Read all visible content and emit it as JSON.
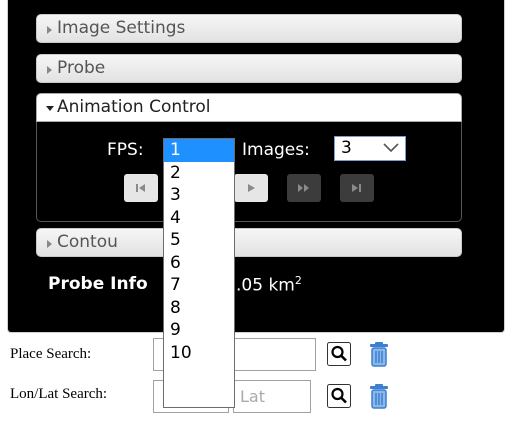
{
  "accordion": {
    "image_settings_label": "Image Settings",
    "probe_label": "Probe",
    "animation_control_label": "Animation Control",
    "contour_label": "Contou"
  },
  "animation": {
    "fps_label": "FPS:",
    "fps_value": "1",
    "images_label": "Images:",
    "images_value": "3",
    "fps_options": [
      "1",
      "2",
      "3",
      "4",
      "5",
      "6",
      "7",
      "8",
      "9",
      "10"
    ]
  },
  "probe_info": {
    "label": "Probe Info",
    "value_text": ".05 km",
    "unit_sup": "2"
  },
  "place_search": {
    "label": "Place Search:",
    "value": ""
  },
  "lonlat_search": {
    "label": "Lon/Lat Search:",
    "lon_value": "",
    "lat_placeholder": "Lat"
  },
  "icons": {
    "first": "skip-to-first-icon",
    "prev": "step-back-icon",
    "play": "play-icon",
    "next": "step-forward-icon",
    "last": "skip-to-last-icon",
    "search": "magnifier-icon",
    "clear": "trash-icon"
  }
}
